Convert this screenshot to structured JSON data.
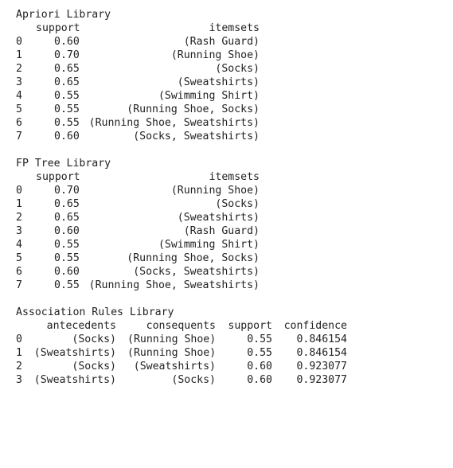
{
  "blocks": [
    {
      "title": "Apriori Library",
      "headers": [
        "support",
        "itemsets"
      ],
      "rows": [
        {
          "index": "0",
          "support": "0.60",
          "itemsets": "(Rash Guard)"
        },
        {
          "index": "1",
          "support": "0.70",
          "itemsets": "(Running Shoe)"
        },
        {
          "index": "2",
          "support": "0.65",
          "itemsets": "(Socks)"
        },
        {
          "index": "3",
          "support": "0.65",
          "itemsets": "(Sweatshirts)"
        },
        {
          "index": "4",
          "support": "0.55",
          "itemsets": "(Swimming Shirt)"
        },
        {
          "index": "5",
          "support": "0.55",
          "itemsets": "(Running Shoe, Socks)"
        },
        {
          "index": "6",
          "support": "0.55",
          "itemsets": "(Running Shoe, Sweatshirts)"
        },
        {
          "index": "7",
          "support": "0.60",
          "itemsets": "(Socks, Sweatshirts)"
        }
      ]
    },
    {
      "title": "FP Tree Library",
      "headers": [
        "support",
        "itemsets"
      ],
      "rows": [
        {
          "index": "0",
          "support": "0.70",
          "itemsets": "(Running Shoe)"
        },
        {
          "index": "1",
          "support": "0.65",
          "itemsets": "(Socks)"
        },
        {
          "index": "2",
          "support": "0.65",
          "itemsets": "(Sweatshirts)"
        },
        {
          "index": "3",
          "support": "0.60",
          "itemsets": "(Rash Guard)"
        },
        {
          "index": "4",
          "support": "0.55",
          "itemsets": "(Swimming Shirt)"
        },
        {
          "index": "5",
          "support": "0.55",
          "itemsets": "(Running Shoe, Socks)"
        },
        {
          "index": "6",
          "support": "0.60",
          "itemsets": "(Socks, Sweatshirts)"
        },
        {
          "index": "7",
          "support": "0.55",
          "itemsets": "(Running Shoe, Sweatshirts)"
        }
      ]
    },
    {
      "title": "Association Rules Library",
      "headers": [
        "antecedents",
        "consequents",
        "support",
        "confidence"
      ],
      "rows": [
        {
          "index": "0",
          "antecedents": "(Socks)",
          "consequents": "(Running Shoe)",
          "support": "0.55",
          "confidence": "0.846154"
        },
        {
          "index": "1",
          "antecedents": "(Sweatshirts)",
          "consequents": "(Running Shoe)",
          "support": "0.55",
          "confidence": "0.846154"
        },
        {
          "index": "2",
          "antecedents": "(Socks)",
          "consequents": "(Sweatshirts)",
          "support": "0.60",
          "confidence": "0.923077"
        },
        {
          "index": "3",
          "antecedents": "(Sweatshirts)",
          "consequents": "(Socks)",
          "support": "0.60",
          "confidence": "0.923077"
        }
      ]
    }
  ]
}
